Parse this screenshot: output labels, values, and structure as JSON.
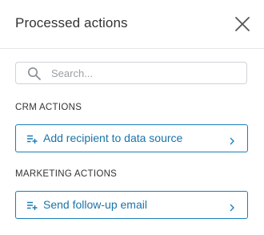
{
  "header": {
    "title": "Processed actions",
    "close_icon": "close-icon"
  },
  "search": {
    "placeholder": "Search...",
    "value": "",
    "icon": "search-icon"
  },
  "sections": [
    {
      "label": "CRM ACTIONS",
      "actions": [
        {
          "label": "Add recipient to data source",
          "icon": "playlist-add-icon"
        }
      ]
    },
    {
      "label": "MARKETING ACTIONS",
      "actions": [
        {
          "label": "Send follow-up email",
          "icon": "playlist-add-icon"
        }
      ]
    }
  ],
  "colors": {
    "accent": "#1a7fb5",
    "text": "#333333",
    "border": "#cfd3d7",
    "divider": "#e6e6e6"
  }
}
